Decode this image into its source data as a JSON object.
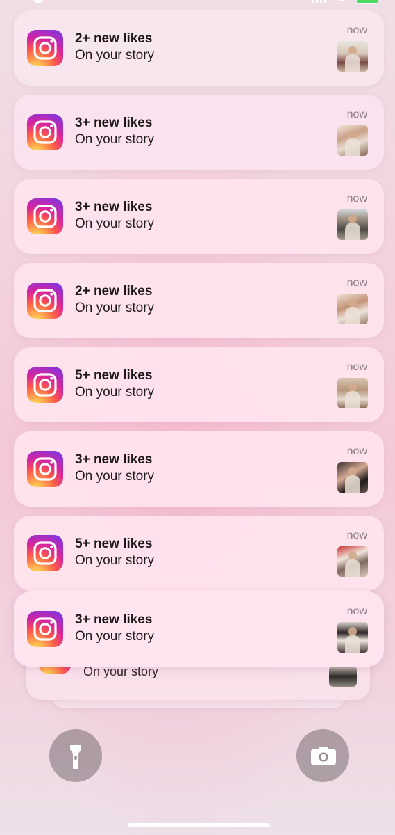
{
  "app": {
    "name": "Instagram",
    "icon": "instagram-icon",
    "colors": {
      "icon_gradient": [
        "#fdf497",
        "#fdcb52",
        "#fd5949",
        "#d6249f",
        "#6b3af0"
      ],
      "card_background": "#ffe4ee"
    }
  },
  "notifications": [
    {
      "title": "2+ new likes",
      "subtitle": "On your story",
      "time": "now"
    },
    {
      "title": "3+ new likes",
      "subtitle": "On your story",
      "time": "now"
    },
    {
      "title": "3+ new likes",
      "subtitle": "On your story",
      "time": "now"
    },
    {
      "title": "2+ new likes",
      "subtitle": "On your story",
      "time": "now"
    },
    {
      "title": "5+ new likes",
      "subtitle": "On your story",
      "time": "now"
    },
    {
      "title": "3+ new likes",
      "subtitle": "On your story",
      "time": "now"
    },
    {
      "title": "5+ new likes",
      "subtitle": "On your story",
      "time": "now"
    },
    {
      "title": "3+ new likes",
      "subtitle": "On your story",
      "time": "now"
    }
  ],
  "stacked_notification": {
    "subtitle": "On your story"
  },
  "lockscreen": {
    "left_button_icon": "flashlight-icon",
    "right_button_icon": "camera-icon"
  }
}
